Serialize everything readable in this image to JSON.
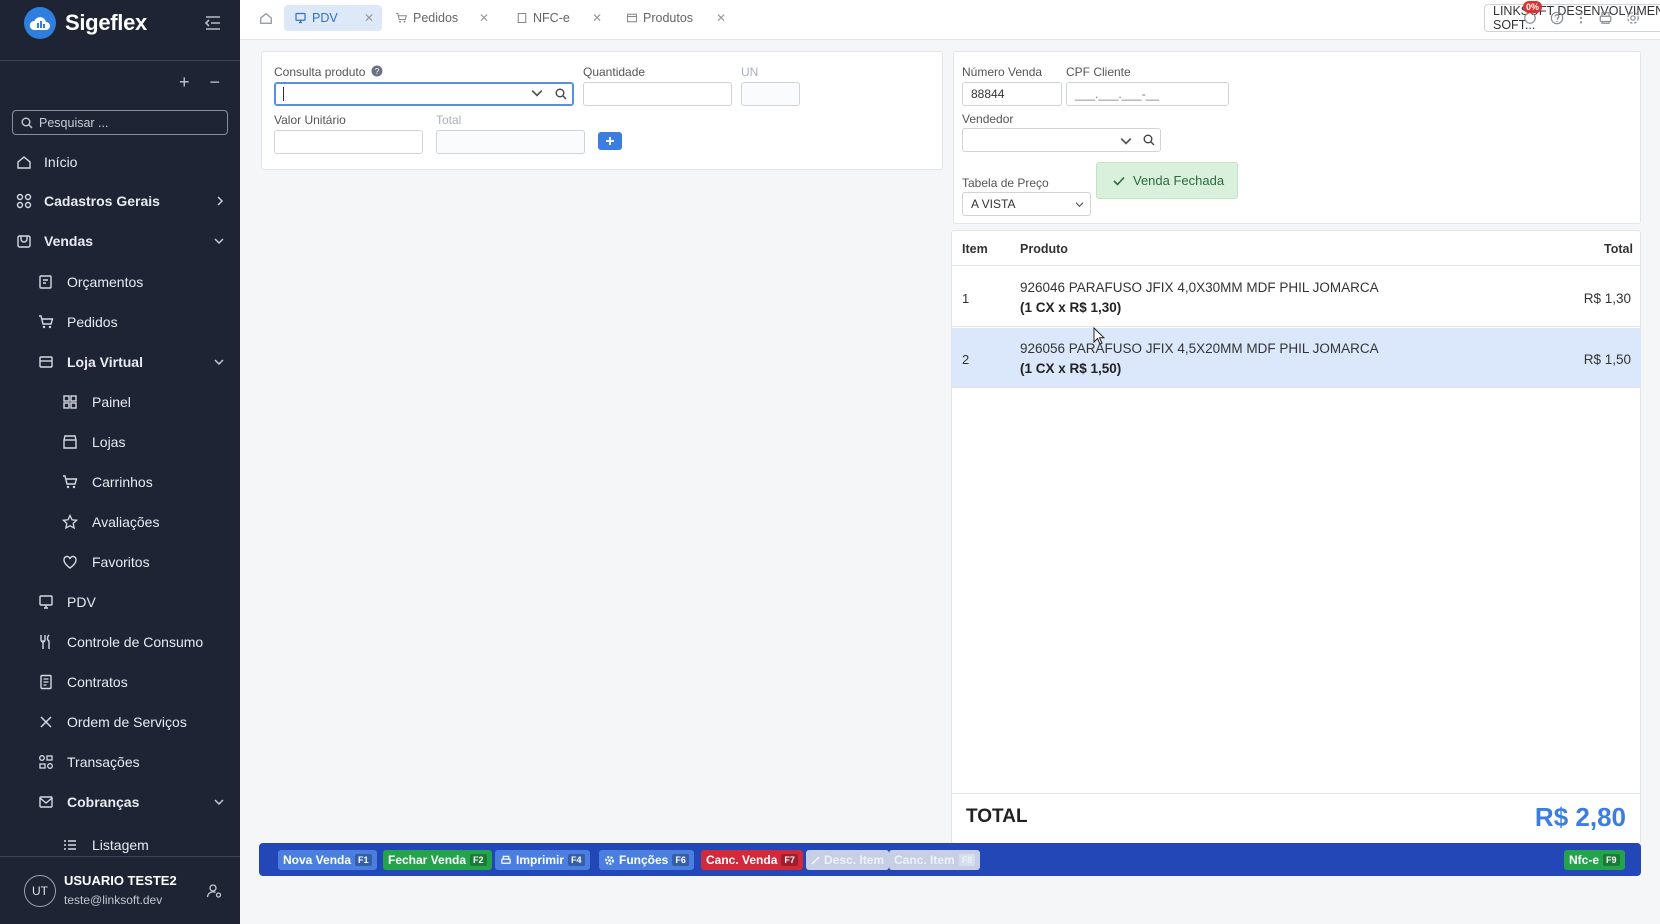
{
  "app": {
    "brand": "Sigeflex"
  },
  "sidebar": {
    "search_placeholder": "Pesquisar ...",
    "items": [
      {
        "label": "Início",
        "icon": "home-icon"
      },
      {
        "label": "Cadastros Gerais",
        "icon": "grid-icon"
      },
      {
        "label": "Vendas",
        "icon": "store-icon"
      },
      {
        "label": "Orçamentos",
        "icon": "edit-doc-icon"
      },
      {
        "label": "Pedidos",
        "icon": "cart-icon"
      },
      {
        "label": "Loja Virtual",
        "icon": "shop-icon"
      },
      {
        "label": "Painel",
        "icon": "dashboard-icon"
      },
      {
        "label": "Lojas",
        "icon": "storefront-icon"
      },
      {
        "label": "Carrinhos",
        "icon": "cart-icon"
      },
      {
        "label": "Avaliações",
        "icon": "star-icon"
      },
      {
        "label": "Favoritos",
        "icon": "heart-icon"
      },
      {
        "label": "PDV",
        "icon": "monitor-icon"
      },
      {
        "label": "Controle de Consumo",
        "icon": "cutlery-icon"
      },
      {
        "label": "Contratos",
        "icon": "document-icon"
      },
      {
        "label": "Ordem de Serviços",
        "icon": "tools-icon"
      },
      {
        "label": "Transações",
        "icon": "transactions-icon"
      },
      {
        "label": "Cobranças",
        "icon": "mail-icon"
      },
      {
        "label": "Listagem",
        "icon": "list-icon"
      }
    ],
    "user": {
      "initials": "UT",
      "name": "USUARIO TESTE2",
      "email": "teste@linksoft.dev"
    }
  },
  "topbar": {
    "tabs": [
      {
        "label": "PDV",
        "active": true
      },
      {
        "label": "Pedidos",
        "active": false
      },
      {
        "label": "NFC-e",
        "active": false
      },
      {
        "label": "Produtos",
        "active": false
      }
    ],
    "company": "LINKSOFT DESENVOLVIMENTO DE SOFT...",
    "notification_badge": "0%"
  },
  "product_form": {
    "consulta_label": "Consulta produto",
    "quantidade_label": "Quantidade",
    "un_label": "UN",
    "valor_unitario_label": "Valor Unitário",
    "total_label": "Total"
  },
  "sale_form": {
    "numero_venda_label": "Número Venda",
    "numero_venda_value": "88844",
    "cpf_label": "CPF Cliente",
    "cpf_placeholder": "___.___.___-__",
    "vendedor_label": "Vendedor",
    "tabela_label": "Tabela de Preço",
    "tabela_value": "A VISTA",
    "status_message": "Venda Fechada"
  },
  "items_table": {
    "headers": {
      "item": "Item",
      "produto": "Produto",
      "total": "Total"
    },
    "rows": [
      {
        "item": "1",
        "produto": "926046 PARAFUSO JFIX 4,0X30MM MDF PHIL JOMARCA",
        "detalhe": "(1 CX x R$ 1,30)",
        "total": "R$ 1,30"
      },
      {
        "item": "2",
        "produto": "926056 PARAFUSO JFIX 4,5X20MM MDF PHIL JOMARCA",
        "detalhe": "(1 CX x R$ 1,50)",
        "total": "R$ 1,50"
      }
    ],
    "total_label": "TOTAL",
    "total_value": "R$ 2,80"
  },
  "actions": [
    {
      "label": "Nova Venda",
      "key": "F1"
    },
    {
      "label": "Fechar Venda",
      "key": "F2"
    },
    {
      "label": "Imprimir",
      "key": "F4"
    },
    {
      "label": "Funções",
      "key": "F6"
    },
    {
      "label": "Canc. Venda",
      "key": "F7"
    },
    {
      "label": "Desc. Item",
      "key": ""
    },
    {
      "label": "Canc. Item",
      "key": "F8"
    },
    {
      "label": "Nfc-e",
      "key": "F9"
    }
  ],
  "colors": {
    "accent": "#3b7de0",
    "sidebar_bg": "#1e2433",
    "action_bar": "#2447b8",
    "success": "#23a34a",
    "danger": "#d22a3a"
  }
}
